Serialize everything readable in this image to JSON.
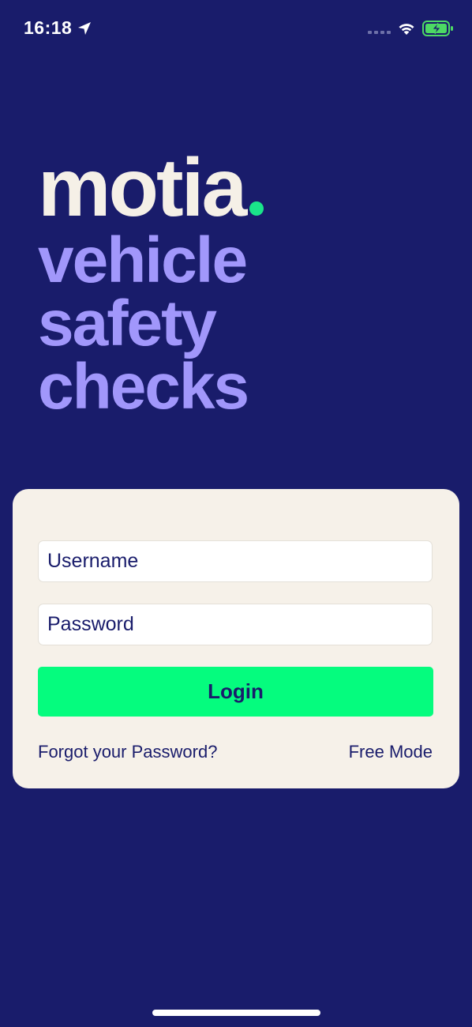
{
  "status_bar": {
    "time": "16:18",
    "icons": [
      "location-arrow-icon",
      "cellular-signal-icon",
      "wifi-icon",
      "battery-charging-icon"
    ]
  },
  "brand": {
    "logo_text": "motia",
    "tagline": [
      "vehicle",
      "safety",
      "checks"
    ]
  },
  "login_form": {
    "username_placeholder": "Username",
    "username_value": "",
    "password_placeholder": "Password",
    "password_value": "",
    "login_label": "Login",
    "forgot_password_label": "Forgot your Password?",
    "free_mode_label": "Free Mode"
  },
  "colors": {
    "background": "#191c6b",
    "tagline": "#a197fb",
    "logo": "#f5f0e7",
    "logo_dot": "#1ae48a",
    "card": "#f6f1e9",
    "login_button": "#05fc7e",
    "text_dark": "#191c6b",
    "battery": "#4cd964"
  }
}
